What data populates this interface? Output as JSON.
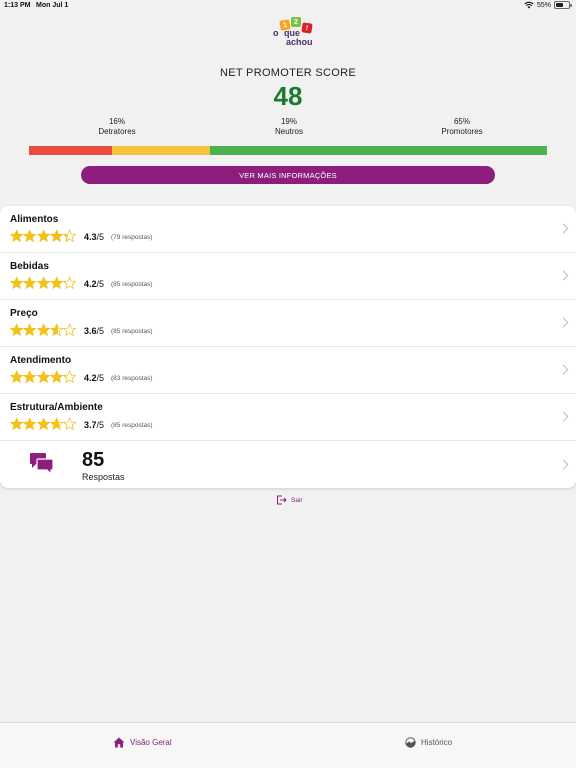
{
  "status_bar": {
    "time": "1:13 PM",
    "date": "Mon Jul 1",
    "battery": "55%",
    "battery_level": 0.55
  },
  "logo": {
    "line1": "o",
    "line2": "que",
    "line3": "achou",
    "marks": [
      "1",
      "2",
      "!"
    ]
  },
  "nps": {
    "title": "NET PROMOTER SCORE",
    "score": "48",
    "segments": [
      {
        "percent": "16%",
        "label": "Detratores",
        "share": 16,
        "color": "#e74c3c"
      },
      {
        "percent": "19%",
        "label": "Neutros",
        "share": 19,
        "color": "#f7c23c"
      },
      {
        "percent": "65%",
        "label": "Promotores",
        "share": 65,
        "color": "#4caf50"
      }
    ],
    "more_button": "VER MAIS INFORMAÇÕES"
  },
  "ratings": [
    {
      "label": "Alimentos",
      "score": "4.3",
      "max": "/5",
      "count": "(79 respostas)",
      "stars": 4.3
    },
    {
      "label": "Bebidas",
      "score": "4.2",
      "max": "/5",
      "count": "(85 respostas)",
      "stars": 4.2
    },
    {
      "label": "Preço",
      "score": "3.6",
      "max": "/5",
      "count": "(85 respostas)",
      "stars": 3.6
    },
    {
      "label": "Atendimento",
      "score": "4.2",
      "max": "/5",
      "count": "(83 respostas)",
      "stars": 4.2
    },
    {
      "label": "Estrutura/Ambiente",
      "score": "3.7",
      "max": "/5",
      "count": "(85 respostas)",
      "stars": 3.7
    }
  ],
  "responses": {
    "total": "85",
    "label": "Respostas"
  },
  "logout": {
    "label": "Sair"
  },
  "tabs": [
    {
      "label": "Visão Geral",
      "icon": "home-icon",
      "active": true
    },
    {
      "label": "Histórico",
      "icon": "history-icon",
      "active": false
    }
  ],
  "colors": {
    "accent": "#8e1e7e",
    "nps_green": "#1a7a2e",
    "star": "#f2c21b"
  }
}
